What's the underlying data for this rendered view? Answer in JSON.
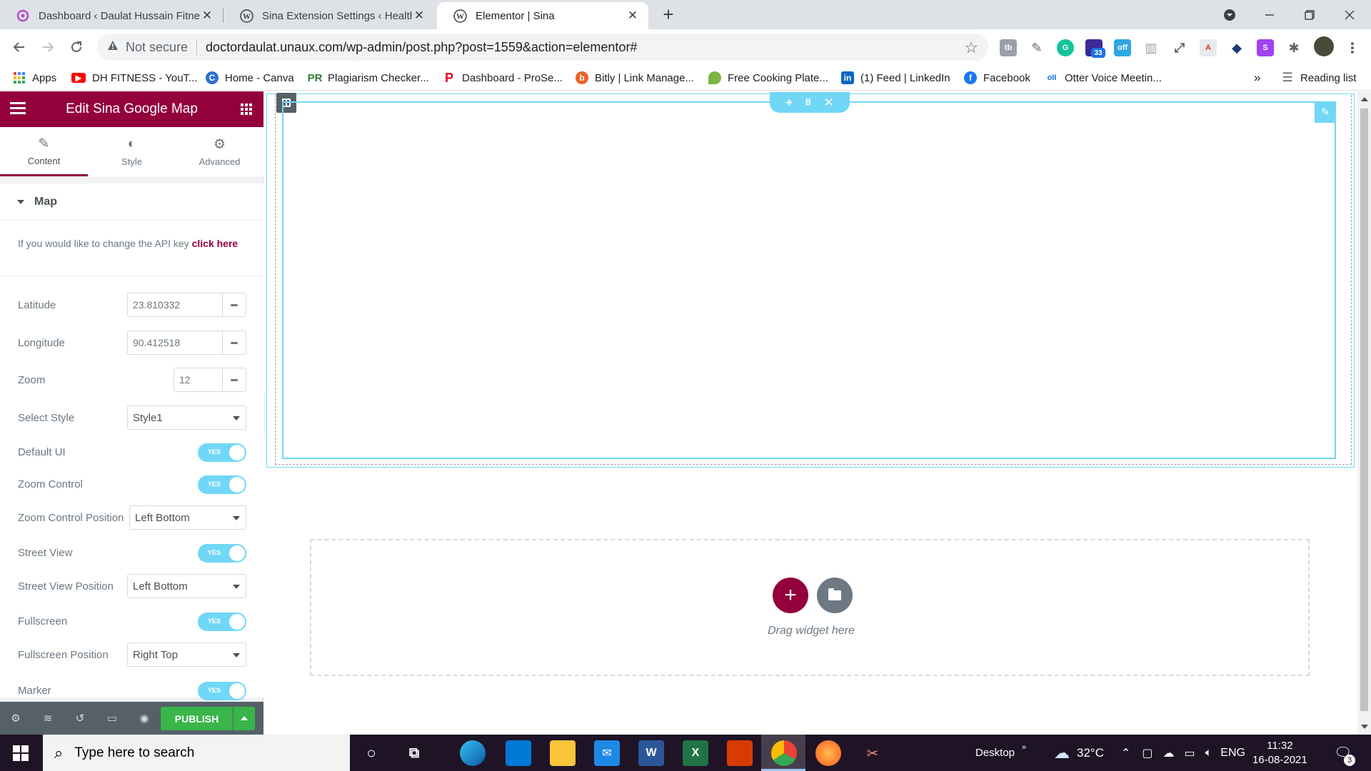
{
  "browser": {
    "tabs": [
      {
        "title": "Dashboard ‹ Daulat Hussain Fitne",
        "favicon": "wordpress-like-pink-icon"
      },
      {
        "title": "Sina Extension Settings ‹ Health &",
        "favicon": "wordpress-icon"
      },
      {
        "title": "Elementor | Sina",
        "favicon": "wordpress-icon"
      }
    ],
    "close_glyph": "✕",
    "new_tab_glyph": "+",
    "address": {
      "security_label": "Not secure",
      "url": "doctordaulat.unaux.com/wp-admin/post.php?post=1559&action=elementor#"
    },
    "extension_badge": "33",
    "bookmarks": [
      {
        "label": "Apps",
        "icon": "apps-grid-icon"
      },
      {
        "label": "DH FITNESS - YouT...",
        "icon": "youtube-icon"
      },
      {
        "label": "Home - Canva",
        "icon": "canva-icon"
      },
      {
        "label": "Plagiarism Checker...",
        "icon": "pr-icon"
      },
      {
        "label": "Dashboard - ProSe...",
        "icon": "pinterest-icon"
      },
      {
        "label": "Bitly | Link Manage...",
        "icon": "bitly-icon"
      },
      {
        "label": "Free Cooking Plate...",
        "icon": "leaf-icon"
      },
      {
        "label": "(1) Feed | LinkedIn",
        "icon": "linkedin-icon"
      },
      {
        "label": "Facebook",
        "icon": "facebook-icon"
      },
      {
        "label": "Otter Voice Meetin...",
        "icon": "otter-icon"
      }
    ],
    "bookmarks_overflow": "»",
    "reading_list": "Reading list"
  },
  "panel": {
    "title": "Edit Sina Google Map",
    "tabs": [
      {
        "label": "Content",
        "active": true
      },
      {
        "label": "Style",
        "active": false
      },
      {
        "label": "Advanced",
        "active": false
      }
    ],
    "section_title": "Map",
    "api_note": "If you would like to change the API key ",
    "api_link": "click here",
    "controls": {
      "latitude": {
        "label": "Latitude",
        "value": "23.810332"
      },
      "longitude": {
        "label": "Longitude",
        "value": "90.412518"
      },
      "zoom": {
        "label": "Zoom",
        "value": "12"
      },
      "select_style": {
        "label": "Select Style",
        "value": "Style1"
      },
      "default_ui": {
        "label": "Default UI",
        "state": "YES"
      },
      "zoom_control": {
        "label": "Zoom Control",
        "state": "YES"
      },
      "zoom_control_position": {
        "label": "Zoom Control Position",
        "value": "Left Bottom"
      },
      "street_view": {
        "label": "Street View",
        "state": "YES"
      },
      "street_view_position": {
        "label": "Street View Position",
        "value": "Left Bottom"
      },
      "fullscreen": {
        "label": "Fullscreen",
        "state": "YES"
      },
      "fullscreen_position": {
        "label": "Fullscreen Position",
        "value": "Right Top"
      },
      "marker": {
        "label": "Marker",
        "state": "YES"
      }
    },
    "publish_label": "PUBLISH"
  },
  "canvas": {
    "drop_text": "Drag widget here",
    "add_glyph": "+"
  },
  "taskbar": {
    "search_placeholder": "Type here to search",
    "desktop_label": "Desktop",
    "temperature": "32°C",
    "language": "ENG",
    "time": "11:32",
    "date": "16-08-2021",
    "notification_count": "3"
  },
  "colors": {
    "elementor_brand": "#93003c",
    "accent_cyan": "#71d7f7",
    "publish_green": "#39b54a",
    "taskbar_bg": "#1f1426"
  }
}
